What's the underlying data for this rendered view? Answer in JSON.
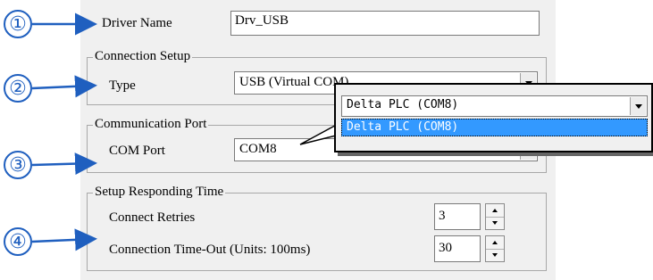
{
  "callouts": [
    "①",
    "②",
    "③",
    "④"
  ],
  "driver": {
    "label": "Driver Name",
    "value": "Drv_USB"
  },
  "connection_setup": {
    "title": "Connection Setup",
    "type_label": "Type",
    "type_value": "USB (Virtual COM)"
  },
  "communication_port": {
    "title": "Communication Port",
    "com_label": "COM Port",
    "com_value": "COM8"
  },
  "responding_time": {
    "title": "Setup Responding Time",
    "retries_label": "Connect Retries",
    "retries_value": "3",
    "timeout_label": "Connection Time-Out (Units: 100ms)",
    "timeout_value": "30"
  },
  "popup": {
    "selected_value": "Delta PLC (COM8)",
    "options": [
      "Delta PLC (COM8)"
    ]
  },
  "colors": {
    "callout": "#1f5fbf",
    "selection": "#3399ff",
    "panel": "#f0f0f0"
  }
}
